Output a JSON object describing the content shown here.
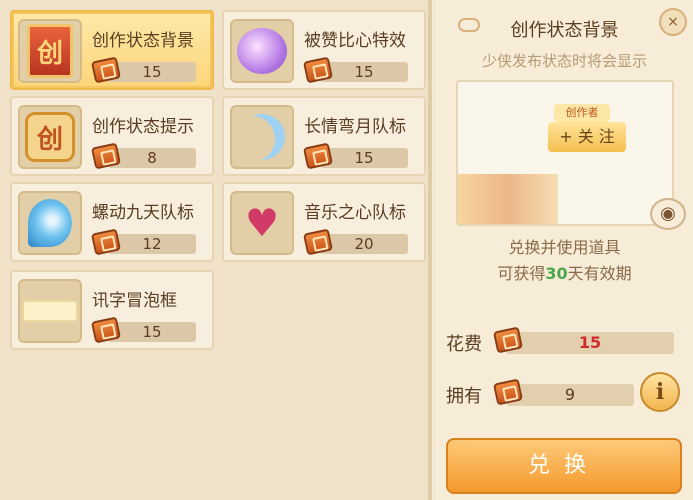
{
  "items": [
    {
      "name": "创作状态背景",
      "price": "15",
      "icon": "chuang-card-icon",
      "selected": true
    },
    {
      "name": "被赞比心特效",
      "price": "15",
      "icon": "heart-gem-icon",
      "selected": false
    },
    {
      "name": "创作状态提示",
      "price": "8",
      "icon": "chuang-badge-icon",
      "selected": false
    },
    {
      "name": "长情弯月队标",
      "price": "15",
      "icon": "crescent-moon-icon",
      "selected": false
    },
    {
      "name": "螺动九天队标",
      "price": "12",
      "icon": "blue-swirl-icon",
      "selected": false
    },
    {
      "name": "音乐之心队标",
      "price": "20",
      "icon": "music-heart-icon",
      "selected": false
    },
    {
      "name": "讯字冒泡框",
      "price": "15",
      "icon": "speech-bubble-icon",
      "selected": false
    }
  ],
  "panel": {
    "title": "创作状态背景",
    "subtitle": "少侠发布状态时将会显示",
    "preview": {
      "tag": "创作者",
      "follow_label": "+ 关 注"
    },
    "info_line1": "兑换并使用道具",
    "info_prefix": "可获得",
    "info_days": "30",
    "info_suffix": "天有效期",
    "cost_label": "花费",
    "cost_value": "15",
    "own_label": "拥有",
    "own_value": "9",
    "info_button": "i",
    "close_button": "×",
    "exchange_label": "兑换"
  },
  "colors": {
    "accent": "#f39a2c",
    "selected_card": "#fdd57a",
    "cost_red": "#d02a2a",
    "days_green": "#4aa84a"
  }
}
